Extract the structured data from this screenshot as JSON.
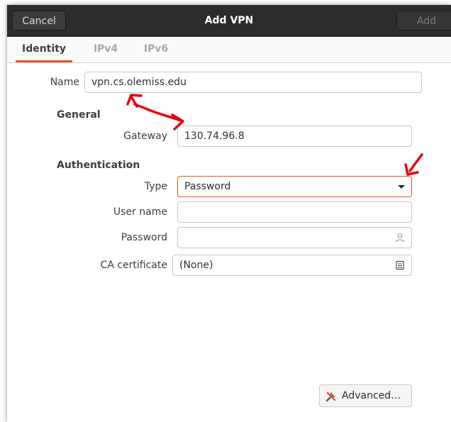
{
  "window": {
    "title": "Add VPN",
    "cancel_label": "Cancel",
    "add_label": "Add"
  },
  "tabs": [
    {
      "label": "Identity",
      "active": true
    },
    {
      "label": "IPv4",
      "active": false
    },
    {
      "label": "IPv6",
      "active": false
    }
  ],
  "name": {
    "label": "Name",
    "value": "vpn.cs.olemiss.edu"
  },
  "general": {
    "heading": "General",
    "gateway_label": "Gateway",
    "gateway_value": "130.74.96.8"
  },
  "authentication": {
    "heading": "Authentication",
    "type_label": "Type",
    "type_value": "Password",
    "username_label": "User name",
    "username_value": "",
    "password_label": "Password",
    "password_value": "",
    "password_icon": "person-icon",
    "ca_label": "CA certificate",
    "ca_value": "(None)",
    "ca_icon": "file-chooser-icon"
  },
  "advanced_label": "Advanced…",
  "colors": {
    "accent": "#e95420",
    "titlebar": "#2c2c2c",
    "annotation": "#e8000b"
  }
}
